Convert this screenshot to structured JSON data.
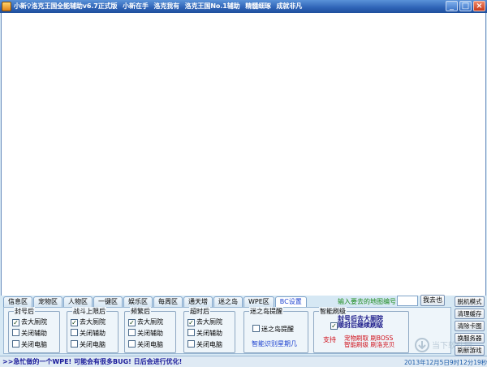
{
  "window": {
    "title_parts": [
      "小新♀洛克王国全能辅助v6.7正式版",
      "小新在手",
      "洛克我有",
      "洛克王国No.1辅助",
      "精髓细琢",
      "成就非凡"
    ],
    "minimize": "_",
    "maximize": "□",
    "close": "×"
  },
  "tabs": [
    "信息区",
    "宠物区",
    "人物区",
    "一键区",
    "娱乐区",
    "每周区",
    "通天塔",
    "迷之岛",
    "WPE区",
    "BC设置"
  ],
  "active_tab_index": 9,
  "map_input": {
    "label": "输入要去的地图编号:",
    "value": "",
    "go_button": "我去也"
  },
  "groups": [
    {
      "label": "封号后",
      "options": [
        {
          "text": "去大厕院",
          "checked": true
        },
        {
          "text": "关闭辅助",
          "checked": false
        },
        {
          "text": "关闭电脑",
          "checked": false
        }
      ]
    },
    {
      "label": "战斗上限后",
      "options": [
        {
          "text": "去大厕院",
          "checked": true
        },
        {
          "text": "关闭辅助",
          "checked": false
        },
        {
          "text": "关闭电脑",
          "checked": false
        }
      ]
    },
    {
      "label": "频繁后",
      "options": [
        {
          "text": "去大厕院",
          "checked": true
        },
        {
          "text": "关闭辅助",
          "checked": false
        },
        {
          "text": "关闭电脑",
          "checked": false
        }
      ]
    },
    {
      "label": "超时后",
      "options": [
        {
          "text": "去大厕院",
          "checked": true
        },
        {
          "text": "关闭辅助",
          "checked": false
        },
        {
          "text": "关闭电脑",
          "checked": false
        }
      ]
    }
  ],
  "maze": {
    "label": "迷之岛提醒",
    "checkbox": "迷之岛提醒",
    "checked": false,
    "note": "智能识别星期几"
  },
  "smart": {
    "label": "智能刷级",
    "checked": true,
    "title_line1": "封号后去大厕院",
    "title_line2": "顺封后继续刷级",
    "support": "支持",
    "feature1": "宠物刷取 刷BOSS",
    "feature2": "智能刷级 刷洛克贝"
  },
  "side_buttons": [
    "脱机模式",
    "清理缓存",
    "清除卡图",
    "换服务器",
    "刷新游戏"
  ],
  "status": {
    "message": ">>急忙做的一个WPE! 可能会有很多BUG! 日后会进行优化!",
    "datetime": "2013年12月5日9时12分19秒"
  },
  "watermark": "当下软件园",
  "colors": {
    "titlebar": "#2e63b6",
    "accent_blue": "#1a3fcf",
    "accent_red": "#d0101a",
    "green": "#1a8a1a"
  }
}
